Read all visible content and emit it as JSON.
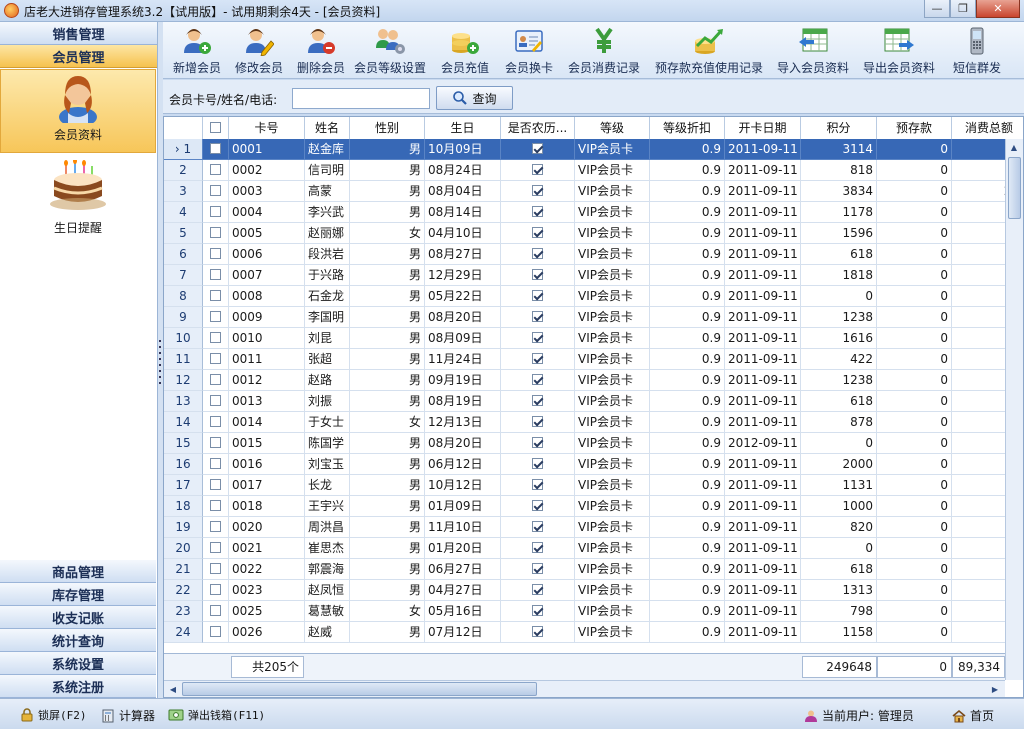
{
  "window": {
    "title": "店老大进销存管理系统3.2【试用版】- 试用期剩余4天 - [会员资料]"
  },
  "sidebar": {
    "top_groups": [
      "销售管理",
      "会员管理"
    ],
    "items": [
      {
        "label": "会员资料",
        "icon": "member-icon"
      },
      {
        "label": "生日提醒",
        "icon": "birthday-cake-icon"
      }
    ],
    "bottom_groups": [
      "商品管理",
      "库存管理",
      "收支记账",
      "统计查询",
      "系统设置",
      "系统注册"
    ]
  },
  "toolbar": {
    "buttons": [
      {
        "label": "新增会员",
        "icon": "add-member-icon"
      },
      {
        "label": "修改会员",
        "icon": "edit-member-icon"
      },
      {
        "label": "删除会员",
        "icon": "delete-member-icon"
      },
      {
        "label": "会员等级设置",
        "icon": "member-level-icon"
      },
      {
        "label": "会员充值",
        "icon": "recharge-icon"
      },
      {
        "label": "会员换卡",
        "icon": "change-card-icon"
      },
      {
        "label": "会员消费记录",
        "icon": "consumption-icon"
      },
      {
        "label": "预存款充值使用记录",
        "icon": "deposit-chart-icon"
      },
      {
        "label": "导入会员资料",
        "icon": "import-icon"
      },
      {
        "label": "导出会员资料",
        "icon": "export-icon"
      },
      {
        "label": "短信群发",
        "icon": "sms-phone-icon"
      }
    ]
  },
  "search": {
    "label": "会员卡号/姓名/电话:",
    "value": "",
    "placeholder": "",
    "button": "查询"
  },
  "grid": {
    "columns": [
      "",
      "",
      "卡号",
      "姓名",
      "性别",
      "生日",
      "是否农历...",
      "等级",
      "等级折扣",
      "开卡日期",
      "积分",
      "预存款",
      "消费总额"
    ],
    "selected_row": 1,
    "rows": [
      {
        "no": "1",
        "card": "0001",
        "name": "赵金库",
        "gender": "男",
        "birthday": "10月09日",
        "lunar": true,
        "level": "VIP会员卡",
        "discount": "0.9",
        "open_date": "2011-09-11",
        "points": "3114",
        "deposit": "0",
        "total": ""
      },
      {
        "no": "2",
        "card": "0002",
        "name": "信司明",
        "gender": "男",
        "birthday": "08月24日",
        "lunar": true,
        "level": "VIP会员卡",
        "discount": "0.9",
        "open_date": "2011-09-11",
        "points": "818",
        "deposit": "0",
        "total": ""
      },
      {
        "no": "3",
        "card": "0003",
        "name": "高蒙",
        "gender": "男",
        "birthday": "08月04日",
        "lunar": true,
        "level": "VIP会员卡",
        "discount": "0.9",
        "open_date": "2011-09-11",
        "points": "3834",
        "deposit": "0",
        "total": "2,1"
      },
      {
        "no": "4",
        "card": "0004",
        "name": "李兴武",
        "gender": "男",
        "birthday": "08月14日",
        "lunar": true,
        "level": "VIP会员卡",
        "discount": "0.9",
        "open_date": "2011-09-11",
        "points": "1178",
        "deposit": "0",
        "total": ""
      },
      {
        "no": "5",
        "card": "0005",
        "name": "赵丽娜",
        "gender": "女",
        "birthday": "04月10日",
        "lunar": true,
        "level": "VIP会员卡",
        "discount": "0.9",
        "open_date": "2011-09-11",
        "points": "1596",
        "deposit": "0",
        "total": ""
      },
      {
        "no": "6",
        "card": "0006",
        "name": "段洪岩",
        "gender": "男",
        "birthday": "08月27日",
        "lunar": true,
        "level": "VIP会员卡",
        "discount": "0.9",
        "open_date": "2011-09-11",
        "points": "618",
        "deposit": "0",
        "total": ""
      },
      {
        "no": "7",
        "card": "0007",
        "name": "于兴路",
        "gender": "男",
        "birthday": "12月29日",
        "lunar": true,
        "level": "VIP会员卡",
        "discount": "0.9",
        "open_date": "2011-09-11",
        "points": "1818",
        "deposit": "0",
        "total": ""
      },
      {
        "no": "8",
        "card": "0008",
        "name": "石金龙",
        "gender": "男",
        "birthday": "05月22日",
        "lunar": true,
        "level": "VIP会员卡",
        "discount": "0.9",
        "open_date": "2011-09-11",
        "points": "0",
        "deposit": "0",
        "total": ""
      },
      {
        "no": "9",
        "card": "0009",
        "name": "李国明",
        "gender": "男",
        "birthday": "08月20日",
        "lunar": true,
        "level": "VIP会员卡",
        "discount": "0.9",
        "open_date": "2011-09-11",
        "points": "1238",
        "deposit": "0",
        "total": ""
      },
      {
        "no": "10",
        "card": "0010",
        "name": "刘昆",
        "gender": "男",
        "birthday": "08月09日",
        "lunar": true,
        "level": "VIP会员卡",
        "discount": "0.9",
        "open_date": "2011-09-11",
        "points": "1616",
        "deposit": "0",
        "total": ""
      },
      {
        "no": "11",
        "card": "0011",
        "name": "张超",
        "gender": "男",
        "birthday": "11月24日",
        "lunar": true,
        "level": "VIP会员卡",
        "discount": "0.9",
        "open_date": "2011-09-11",
        "points": "422",
        "deposit": "0",
        "total": ""
      },
      {
        "no": "12",
        "card": "0012",
        "name": "赵路",
        "gender": "男",
        "birthday": "09月19日",
        "lunar": true,
        "level": "VIP会员卡",
        "discount": "0.9",
        "open_date": "2011-09-11",
        "points": "1238",
        "deposit": "0",
        "total": ""
      },
      {
        "no": "13",
        "card": "0013",
        "name": "刘振",
        "gender": "男",
        "birthday": "08月19日",
        "lunar": true,
        "level": "VIP会员卡",
        "discount": "0.9",
        "open_date": "2011-09-11",
        "points": "618",
        "deposit": "0",
        "total": ""
      },
      {
        "no": "14",
        "card": "0014",
        "name": "于女士",
        "gender": "女",
        "birthday": "12月13日",
        "lunar": true,
        "level": "VIP会员卡",
        "discount": "0.9",
        "open_date": "2011-09-11",
        "points": "878",
        "deposit": "0",
        "total": ""
      },
      {
        "no": "15",
        "card": "0015",
        "name": "陈国学",
        "gender": "男",
        "birthday": "08月20日",
        "lunar": true,
        "level": "VIP会员卡",
        "discount": "0.9",
        "open_date": "2012-09-11",
        "points": "0",
        "deposit": "0",
        "total": ""
      },
      {
        "no": "16",
        "card": "0016",
        "name": "刘宝玉",
        "gender": "男",
        "birthday": "06月12日",
        "lunar": true,
        "level": "VIP会员卡",
        "discount": "0.9",
        "open_date": "2011-09-11",
        "points": "2000",
        "deposit": "0",
        "total": ""
      },
      {
        "no": "17",
        "card": "0017",
        "name": "长龙",
        "gender": "男",
        "birthday": "10月12日",
        "lunar": true,
        "level": "VIP会员卡",
        "discount": "0.9",
        "open_date": "2011-09-11",
        "points": "1131",
        "deposit": "0",
        "total": "5"
      },
      {
        "no": "18",
        "card": "0018",
        "name": "王宇兴",
        "gender": "男",
        "birthday": "01月09日",
        "lunar": true,
        "level": "VIP会员卡",
        "discount": "0.9",
        "open_date": "2011-09-11",
        "points": "1000",
        "deposit": "0",
        "total": ""
      },
      {
        "no": "19",
        "card": "0020",
        "name": "周洪昌",
        "gender": "男",
        "birthday": "11月10日",
        "lunar": true,
        "level": "VIP会员卡",
        "discount": "0.9",
        "open_date": "2011-09-11",
        "points": "820",
        "deposit": "0",
        "total": ""
      },
      {
        "no": "20",
        "card": "0021",
        "name": "崔思杰",
        "gender": "男",
        "birthday": "01月20日",
        "lunar": true,
        "level": "VIP会员卡",
        "discount": "0.9",
        "open_date": "2011-09-11",
        "points": "0",
        "deposit": "0",
        "total": ""
      },
      {
        "no": "21",
        "card": "0022",
        "name": "郭震海",
        "gender": "男",
        "birthday": "06月27日",
        "lunar": true,
        "level": "VIP会员卡",
        "discount": "0.9",
        "open_date": "2011-09-11",
        "points": "618",
        "deposit": "0",
        "total": ""
      },
      {
        "no": "22",
        "card": "0023",
        "name": "赵凤恒",
        "gender": "男",
        "birthday": "04月27日",
        "lunar": true,
        "level": "VIP会员卡",
        "discount": "0.9",
        "open_date": "2011-09-11",
        "points": "1313",
        "deposit": "0",
        "total": ""
      },
      {
        "no": "23",
        "card": "0025",
        "name": "葛慧敏",
        "gender": "女",
        "birthday": "05月16日",
        "lunar": true,
        "level": "VIP会员卡",
        "discount": "0.9",
        "open_date": "2011-09-11",
        "points": "798",
        "deposit": "0",
        "total": ""
      },
      {
        "no": "24",
        "card": "0026",
        "name": "赵威",
        "gender": "男",
        "birthday": "07月12日",
        "lunar": true,
        "level": "VIP会员卡",
        "discount": "0.9",
        "open_date": "2011-09-11",
        "points": "1158",
        "deposit": "0",
        "total": ""
      }
    ],
    "footer": {
      "count": "共205个",
      "points_total": "249648",
      "deposit_total": "0",
      "amount_total": "89,334"
    }
  },
  "statusbar": {
    "lock": "锁屏(F2)",
    "calculator": "计算器",
    "cash_drawer": "弹出钱箱(F11)",
    "user_label": "当前用户: 管理员",
    "home": "首页"
  },
  "colors": {
    "selected_row": "#3768b6",
    "sidebar_active": "#f6c24f"
  }
}
